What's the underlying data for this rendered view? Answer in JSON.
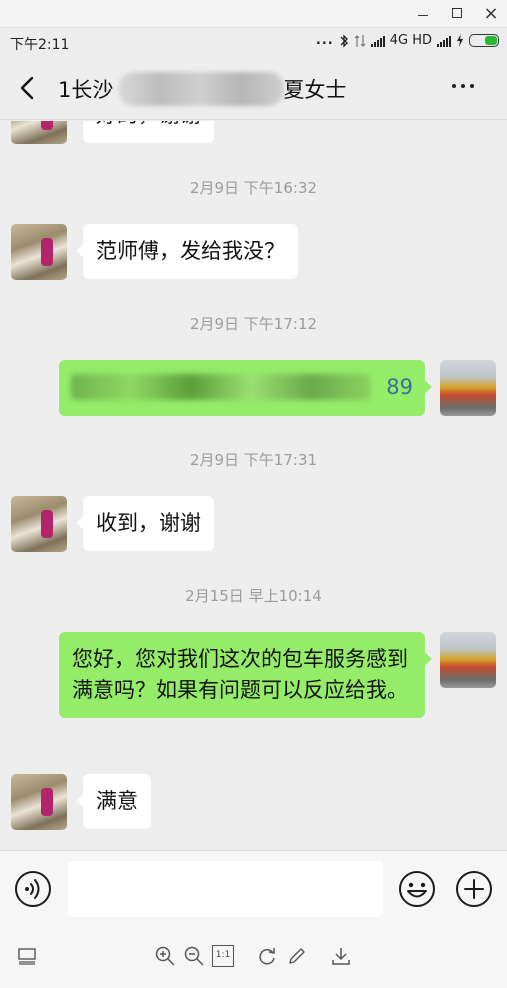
{
  "window": {
    "min_icon": "minimize-icon",
    "max_icon": "maximize-icon",
    "close_label": "×"
  },
  "status": {
    "time": "下午2:11",
    "dots": "...",
    "network": "4G HD"
  },
  "header": {
    "title": "1长沙",
    "title_suffix": "夏女士"
  },
  "messages": [
    {
      "type": "text",
      "side": "left",
      "text": "好的，谢谢"
    },
    {
      "type": "time",
      "text": "2月9日 下午16:32"
    },
    {
      "type": "text",
      "side": "left",
      "text": "范师傅，发给我没？"
    },
    {
      "type": "time",
      "text": "2月9日 下午17:12"
    },
    {
      "type": "text",
      "side": "right",
      "text": "89"
    },
    {
      "type": "time",
      "text": "2月9日 下午17:31"
    },
    {
      "type": "text",
      "side": "left",
      "text": "收到，谢谢"
    },
    {
      "type": "time",
      "text": "2月15日 早上10:14"
    },
    {
      "type": "text",
      "side": "right",
      "text": "您好，您对我们这次的包车服务感到满意吗？如果有问题可以反应给我。"
    },
    {
      "type": "text",
      "side": "left",
      "text": "满意"
    }
  ],
  "input": {
    "value": ""
  },
  "viewer": {
    "actual_size_label": "1:1"
  },
  "colors": {
    "background": "#ededed",
    "bubble_out": "#95ec69",
    "bubble_in": "#ffffff",
    "timestamp": "#9b9b9b",
    "battery": "#2ab935"
  }
}
